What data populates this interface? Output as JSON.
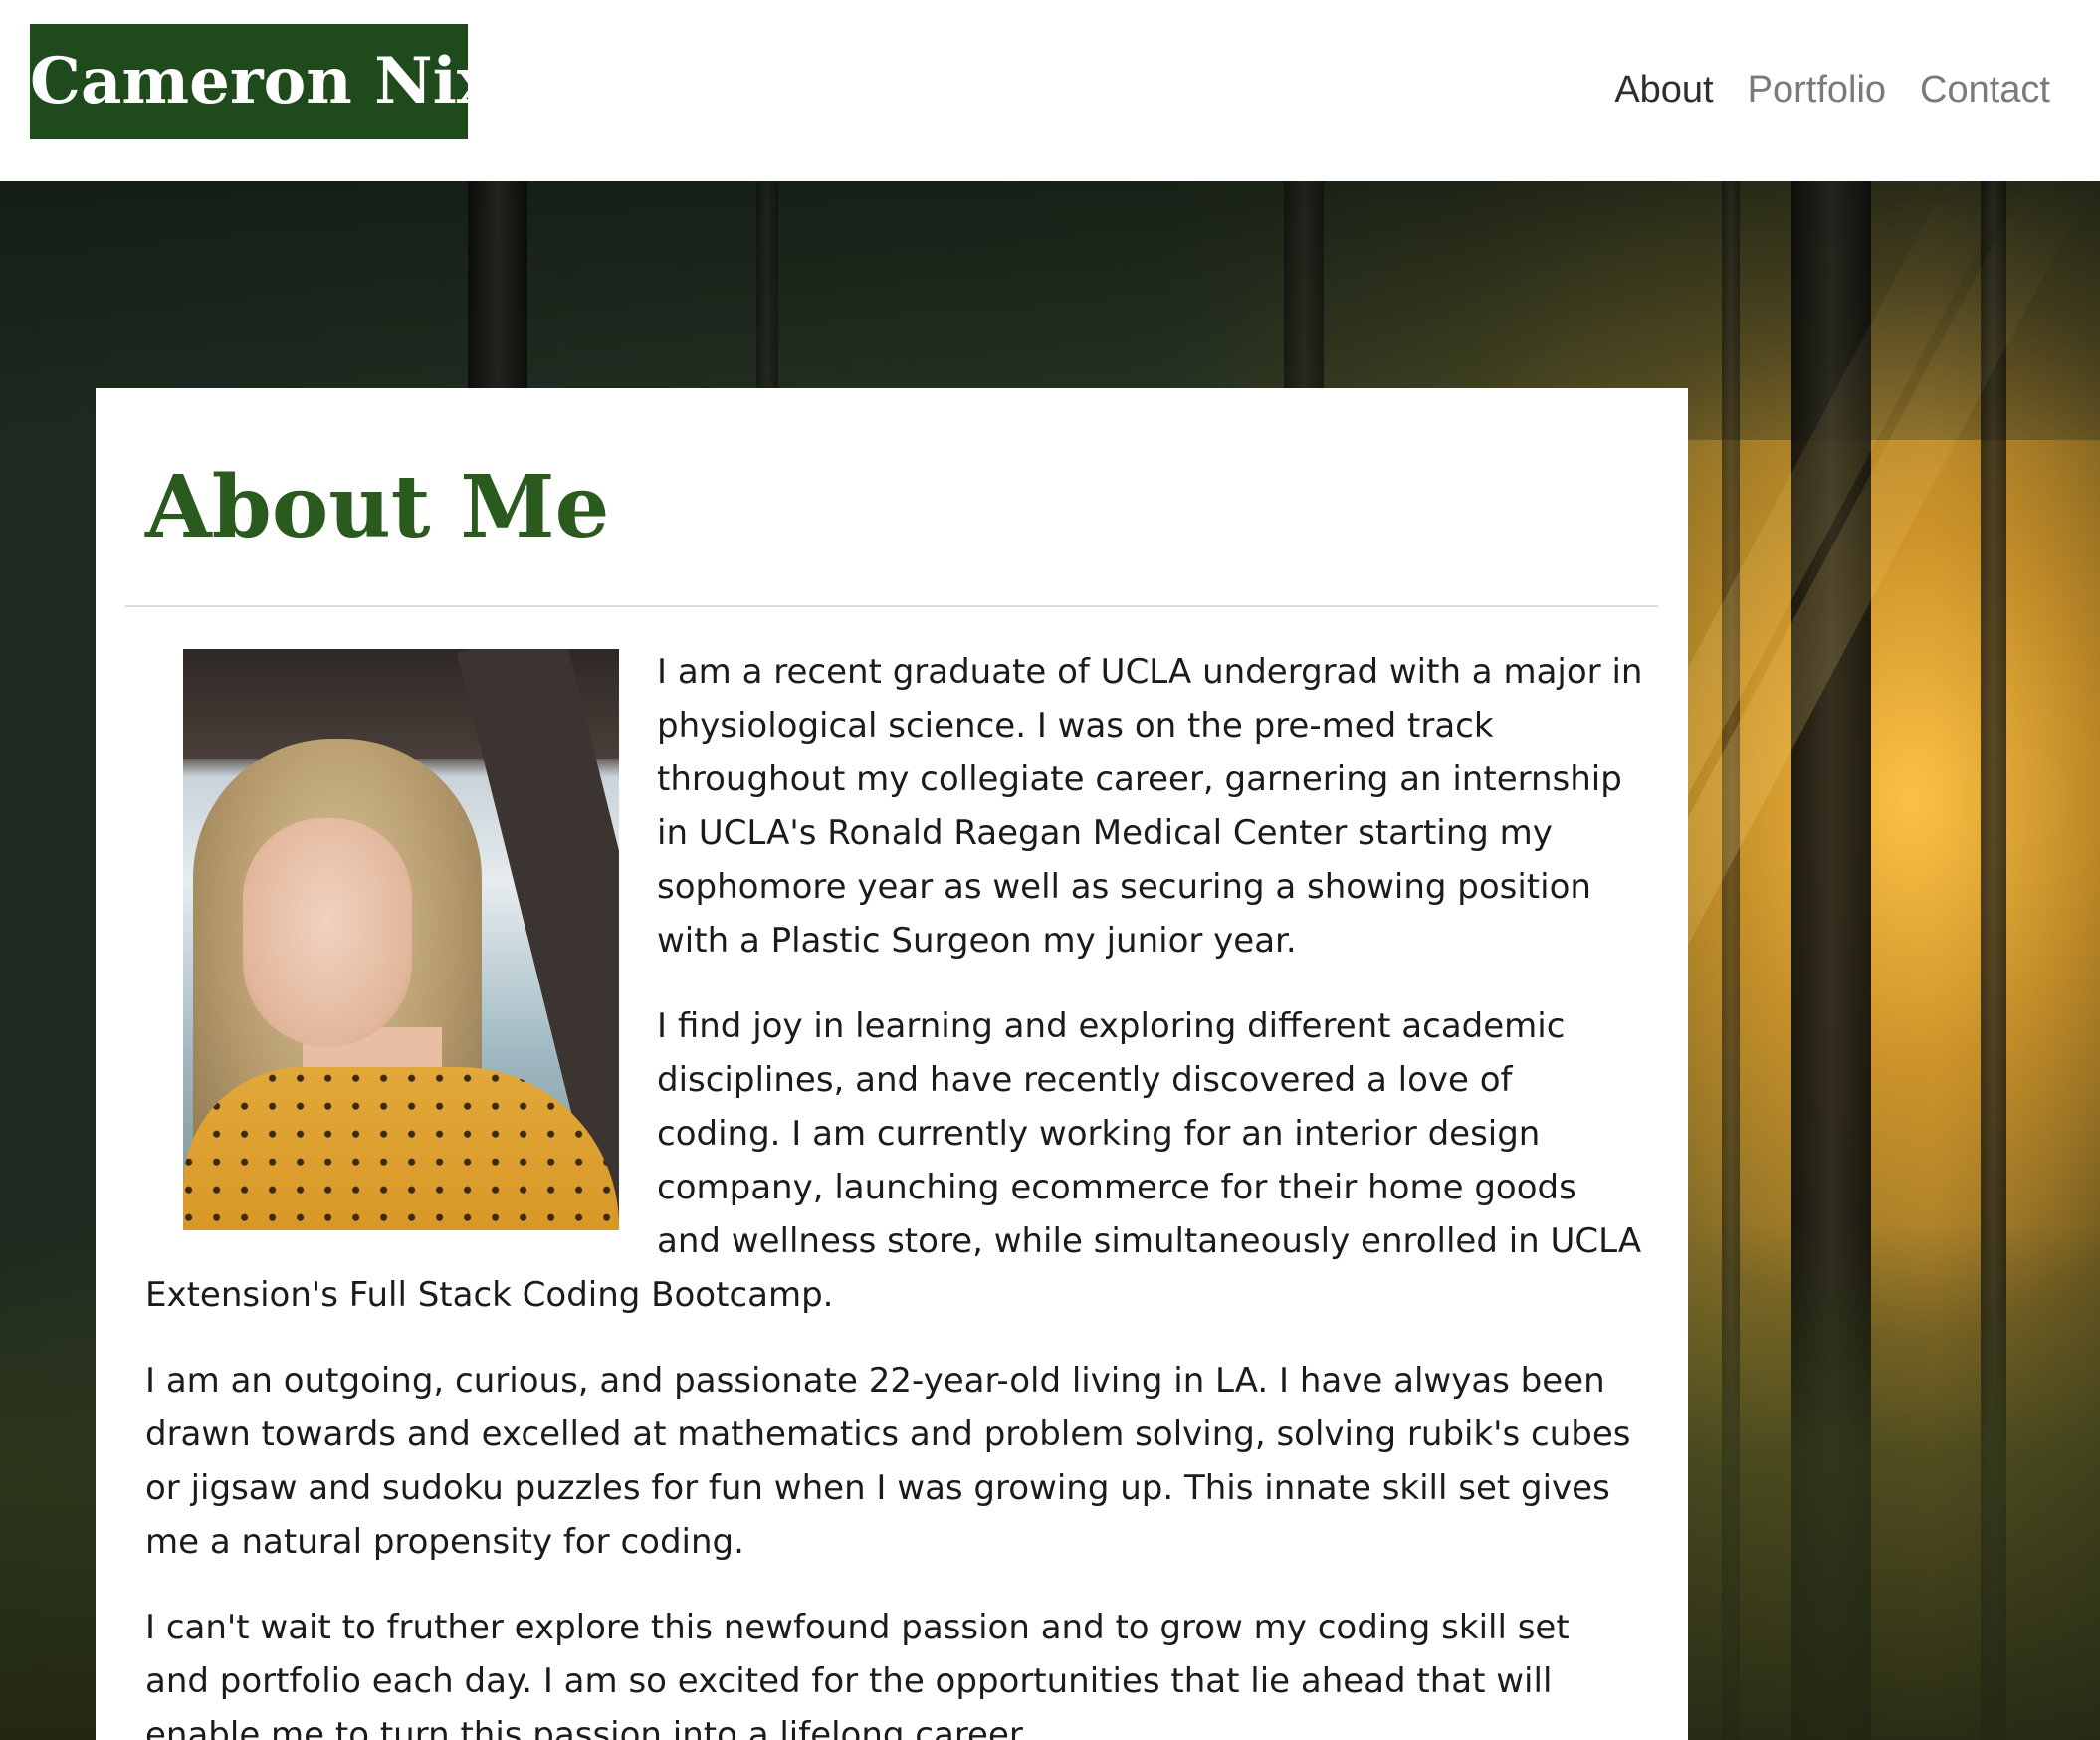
{
  "header": {
    "brand": "Cameron Nix",
    "nav": [
      "About",
      "Portfolio",
      "Contact"
    ],
    "active_nav": "About"
  },
  "about": {
    "title": "About Me",
    "paragraphs": [
      "I am a recent graduate of UCLA undergrad with a major in physiological science. I was on the pre-med track throughout my collegiate career, garnering an internship in UCLA's Ronald Raegan Medical Center starting my sophomore year as well as securing a showing position with a Plastic Surgeon my junior year.",
      "I find joy in learning and exploring different academic disciplines, and have recently discovered a love of coding. I am currently working for an interior design company, launching ecommerce for their home goods and wellness store, while simultaneously enrolled in UCLA Extension's Full Stack Coding Bootcamp.",
      "I am an outgoing, curious, and passionate 22-year-old living in LA. I have alwyas been drawn towards and excelled at mathematics and problem solving, solving rubik's cubes or jigsaw and sudoku puzzles for fun when I was growing up. This innate skill set gives me a natural propensity for coding.",
      "I can't wait to fruther explore this newfound passion and to grow my coding skill set and portfolio each day. I am so excited for the opportunities that lie ahead that will enable me to turn this passion into a lifelong career."
    ]
  },
  "colors": {
    "brand_bg": "#1f4a1b",
    "heading": "#2a5a1e",
    "nav_active": "#2e2e2e",
    "nav_inactive": "#7a7a7a"
  }
}
